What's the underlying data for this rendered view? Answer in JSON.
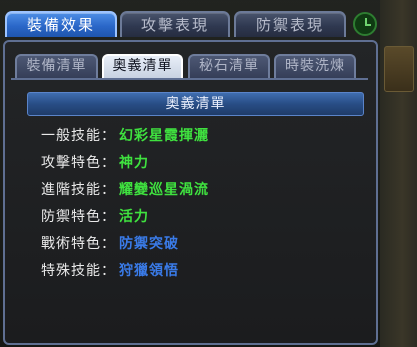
{
  "tabs": {
    "equip_effect": "裝備效果",
    "attack": "攻擊表現",
    "defense": "防禦表現"
  },
  "subtabs": {
    "equip_list": "裝備清單",
    "secret_list": "奧義清單",
    "stone_list": "秘石清單",
    "fashion_wash": "時裝洗煉"
  },
  "section": {
    "title": "奧義清單"
  },
  "rows": [
    {
      "label": "一般技能",
      "colon": "：",
      "value": "幻彩星霞揮灑",
      "color": "#3fe23f"
    },
    {
      "label": "攻擊特色",
      "colon": "：",
      "value": "神力",
      "color": "#3fe23f"
    },
    {
      "label": "進階技能",
      "colon": "：",
      "value": "耀變巡星渦流",
      "color": "#3fe23f"
    },
    {
      "label": "防禦特色",
      "colon": "：",
      "value": "活力",
      "color": "#3fe23f"
    },
    {
      "label": "戰術特色",
      "colon": "：",
      "value": "防禦突破",
      "color": "#3a7be8"
    },
    {
      "label": "特殊技能",
      "colon": "：",
      "value": "狩獵領悟",
      "color": "#3a7be8"
    }
  ],
  "icons": {
    "clock": "clock-icon"
  },
  "colors": {
    "active_tab": "#2a67c8",
    "green_value": "#3fe23f",
    "blue_value": "#3a7be8"
  }
}
